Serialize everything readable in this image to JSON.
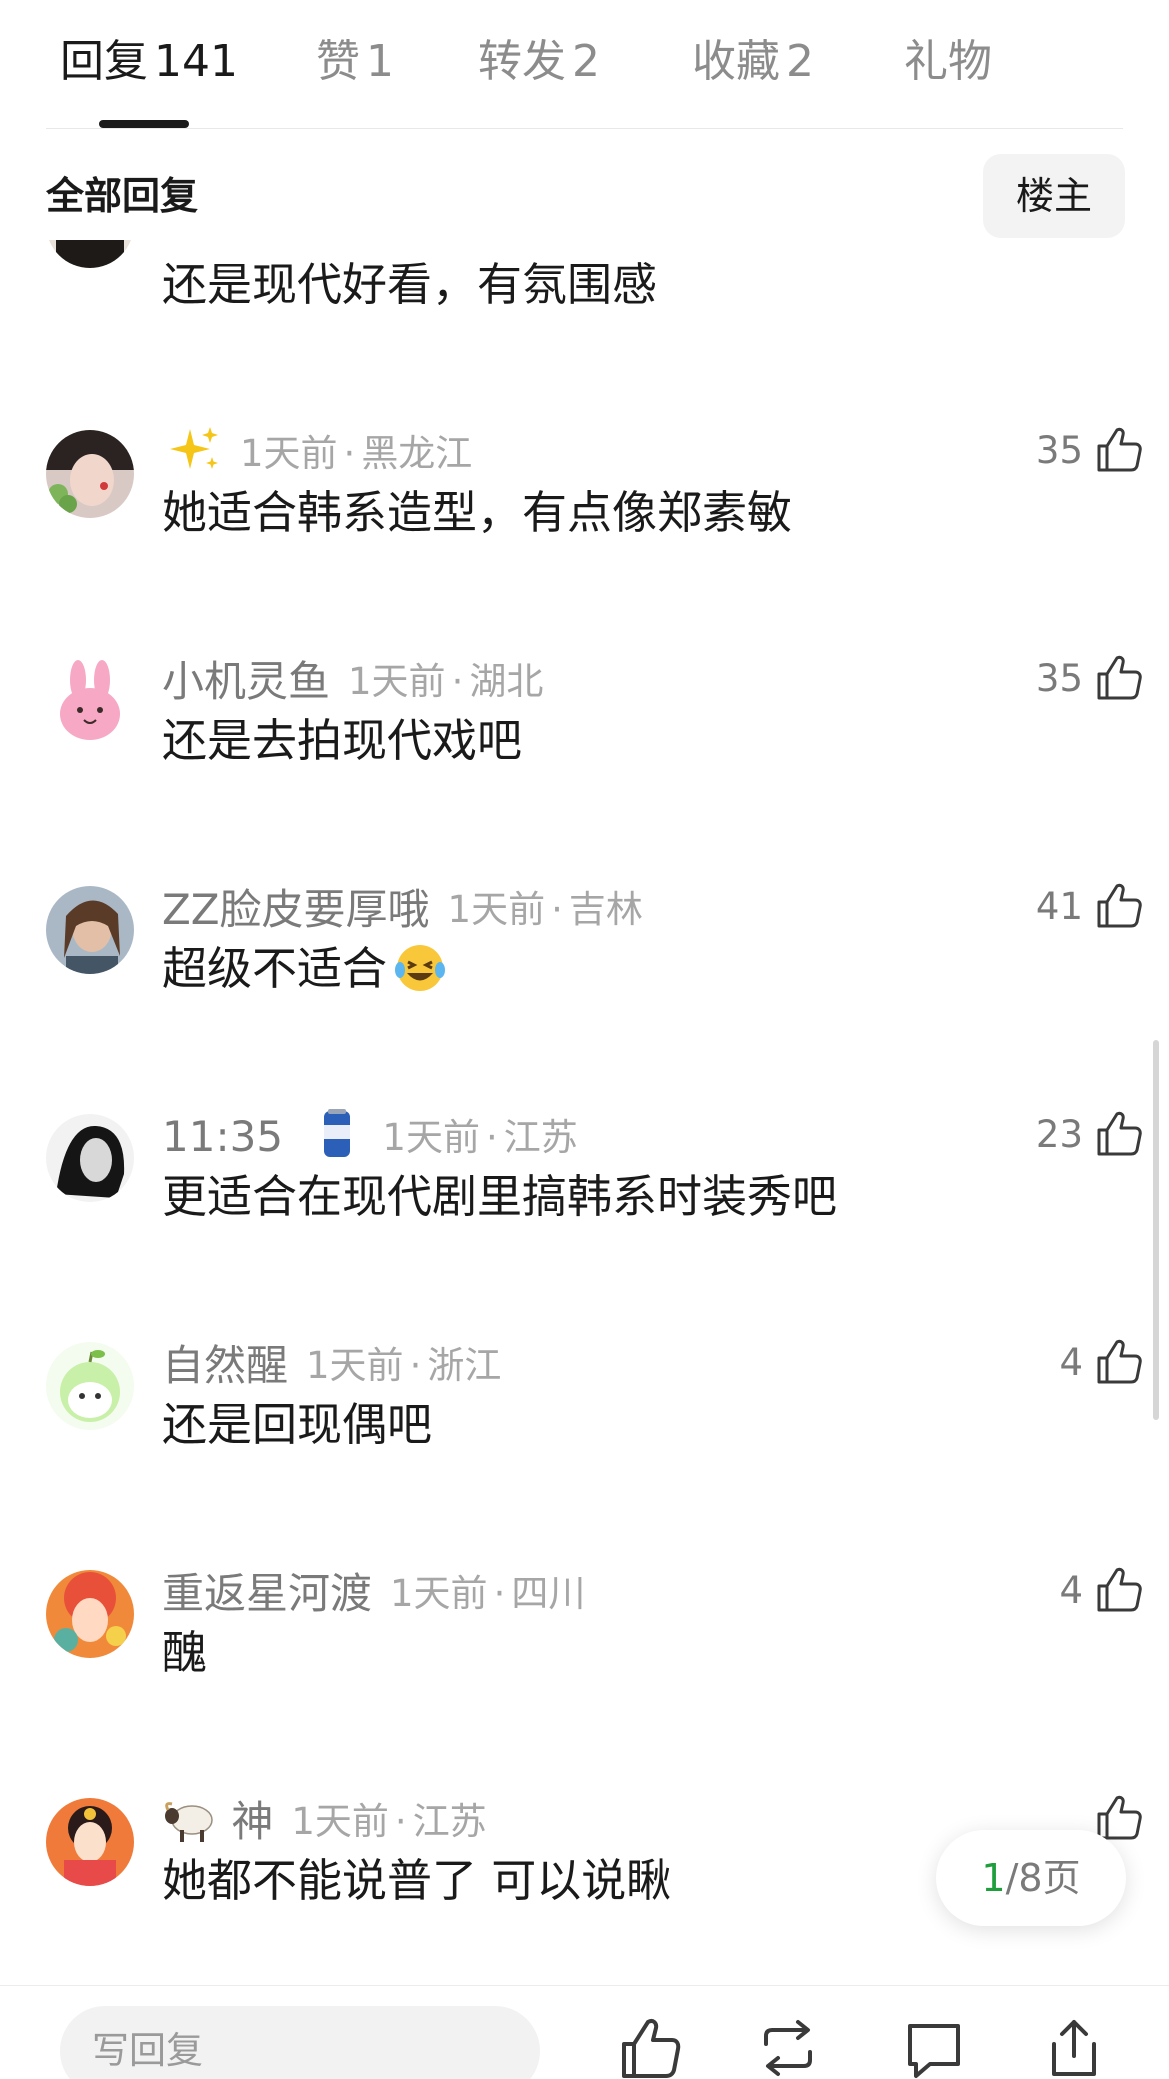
{
  "tabs": [
    {
      "label": "回复",
      "count": "141",
      "active": true
    },
    {
      "label": "赞",
      "count": "1"
    },
    {
      "label": "转发",
      "count": "2"
    },
    {
      "label": "收藏",
      "count": "2"
    },
    {
      "label": "礼物",
      "count": ""
    }
  ],
  "subheader": {
    "title": "全部回复",
    "owner_button": "楼主"
  },
  "comments": [
    {
      "name": "",
      "time": "",
      "location": "",
      "text": "还是现代好看，有氛围感",
      "likes": ""
    },
    {
      "name": "",
      "name_emoji": "sparkles",
      "time": "1天前",
      "location": "黑龙江",
      "text": "她适合韩系造型，有点像郑素敏",
      "likes": "35"
    },
    {
      "name": "小机灵鱼",
      "time": "1天前",
      "location": "湖北",
      "text": "还是去拍现代戏吧",
      "likes": "35"
    },
    {
      "name": "ZZ脸皮要厚哦",
      "time": "1天前",
      "location": "吉林",
      "text": "超级不适合",
      "text_emoji": "laughing-tears",
      "likes": "41"
    },
    {
      "name": "11:35",
      "name_emoji": "beer-can",
      "time": "1天前",
      "location": "江苏",
      "text": "更适合在现代剧里搞韩系时装秀吧",
      "likes": "23"
    },
    {
      "name": "自然醒",
      "time": "1天前",
      "location": "浙江",
      "text": "还是回现偶吧",
      "likes": "4"
    },
    {
      "name": "重返星河渡",
      "time": "1天前",
      "location": "四川",
      "text": "醜",
      "likes": "4"
    },
    {
      "name": "神",
      "name_emoji": "sheep",
      "time": "1天前",
      "location": "江苏",
      "text": "她都不能说普了 可以说瞅",
      "likes": ""
    }
  ],
  "pager": {
    "current": "1",
    "total": "/8页"
  },
  "bottombar": {
    "reply_placeholder": "写回复"
  },
  "colors": {
    "accent_green": "#1f9e3c",
    "text_primary": "#1a1a1a",
    "text_secondary": "#7a7a7a"
  }
}
